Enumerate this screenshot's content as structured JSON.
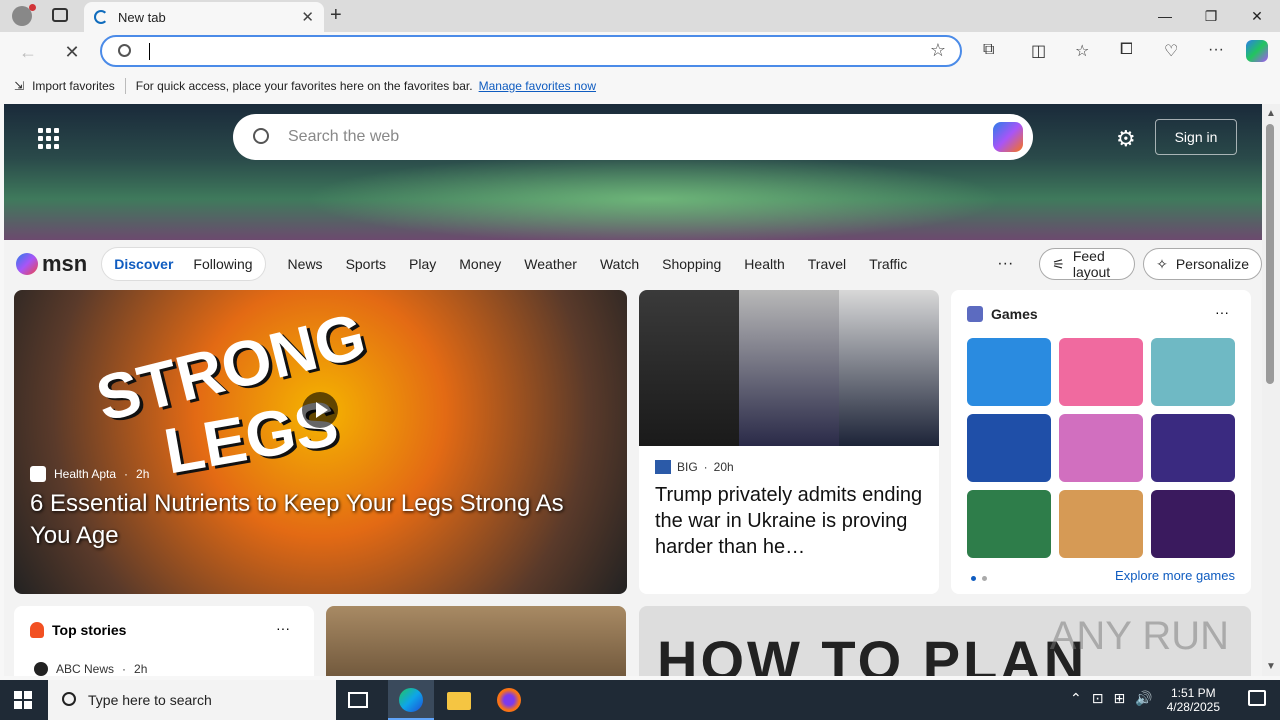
{
  "browser": {
    "tab_title": "New tab",
    "address_value": "",
    "favorites_bar": {
      "import_label": "Import favorites",
      "message": "For quick access, place your favorites here on the favorites bar.",
      "manage_link": "Manage favorites now"
    }
  },
  "msn": {
    "search_placeholder": "Search the web",
    "signin_label": "Sign in",
    "logo_text": "msn",
    "pill_tabs": [
      "Discover",
      "Following"
    ],
    "nav_links": [
      "News",
      "Sports",
      "Play",
      "Money",
      "Weather",
      "Watch",
      "Shopping",
      "Health",
      "Travel",
      "Traffic"
    ],
    "more_label": "···",
    "feed_layout_label": "Feed layout",
    "personalize_label": "Personalize"
  },
  "cards": {
    "hero": {
      "art_word1": "STRONG",
      "art_word2": "LEGS",
      "source": "Health Apta",
      "age": "2h",
      "headline": "6 Essential Nutrients to Keep Your Legs Strong As You Age"
    },
    "news": {
      "source": "BIG",
      "age": "20h",
      "headline": "Trump privately admits ending the war in Ukraine is proving harder than he…"
    },
    "games": {
      "title": "Games",
      "explore_label": "Explore more games",
      "tile_colors": [
        "#2a8be0",
        "#f06a9f",
        "#6fb9c4",
        "#1f4fa8",
        "#d16fbf",
        "#3a2a80",
        "#2e7d4a",
        "#d69a55",
        "#3a1a5e"
      ]
    },
    "top_stories": {
      "title": "Top stories",
      "source": "ABC News",
      "age": "2h"
    },
    "promo": {
      "text": "HOW TO PLAN",
      "watermark": "ANY RUN"
    }
  },
  "taskbar": {
    "search_placeholder": "Type here to search",
    "time": "1:51 PM",
    "date": "4/28/2025"
  }
}
